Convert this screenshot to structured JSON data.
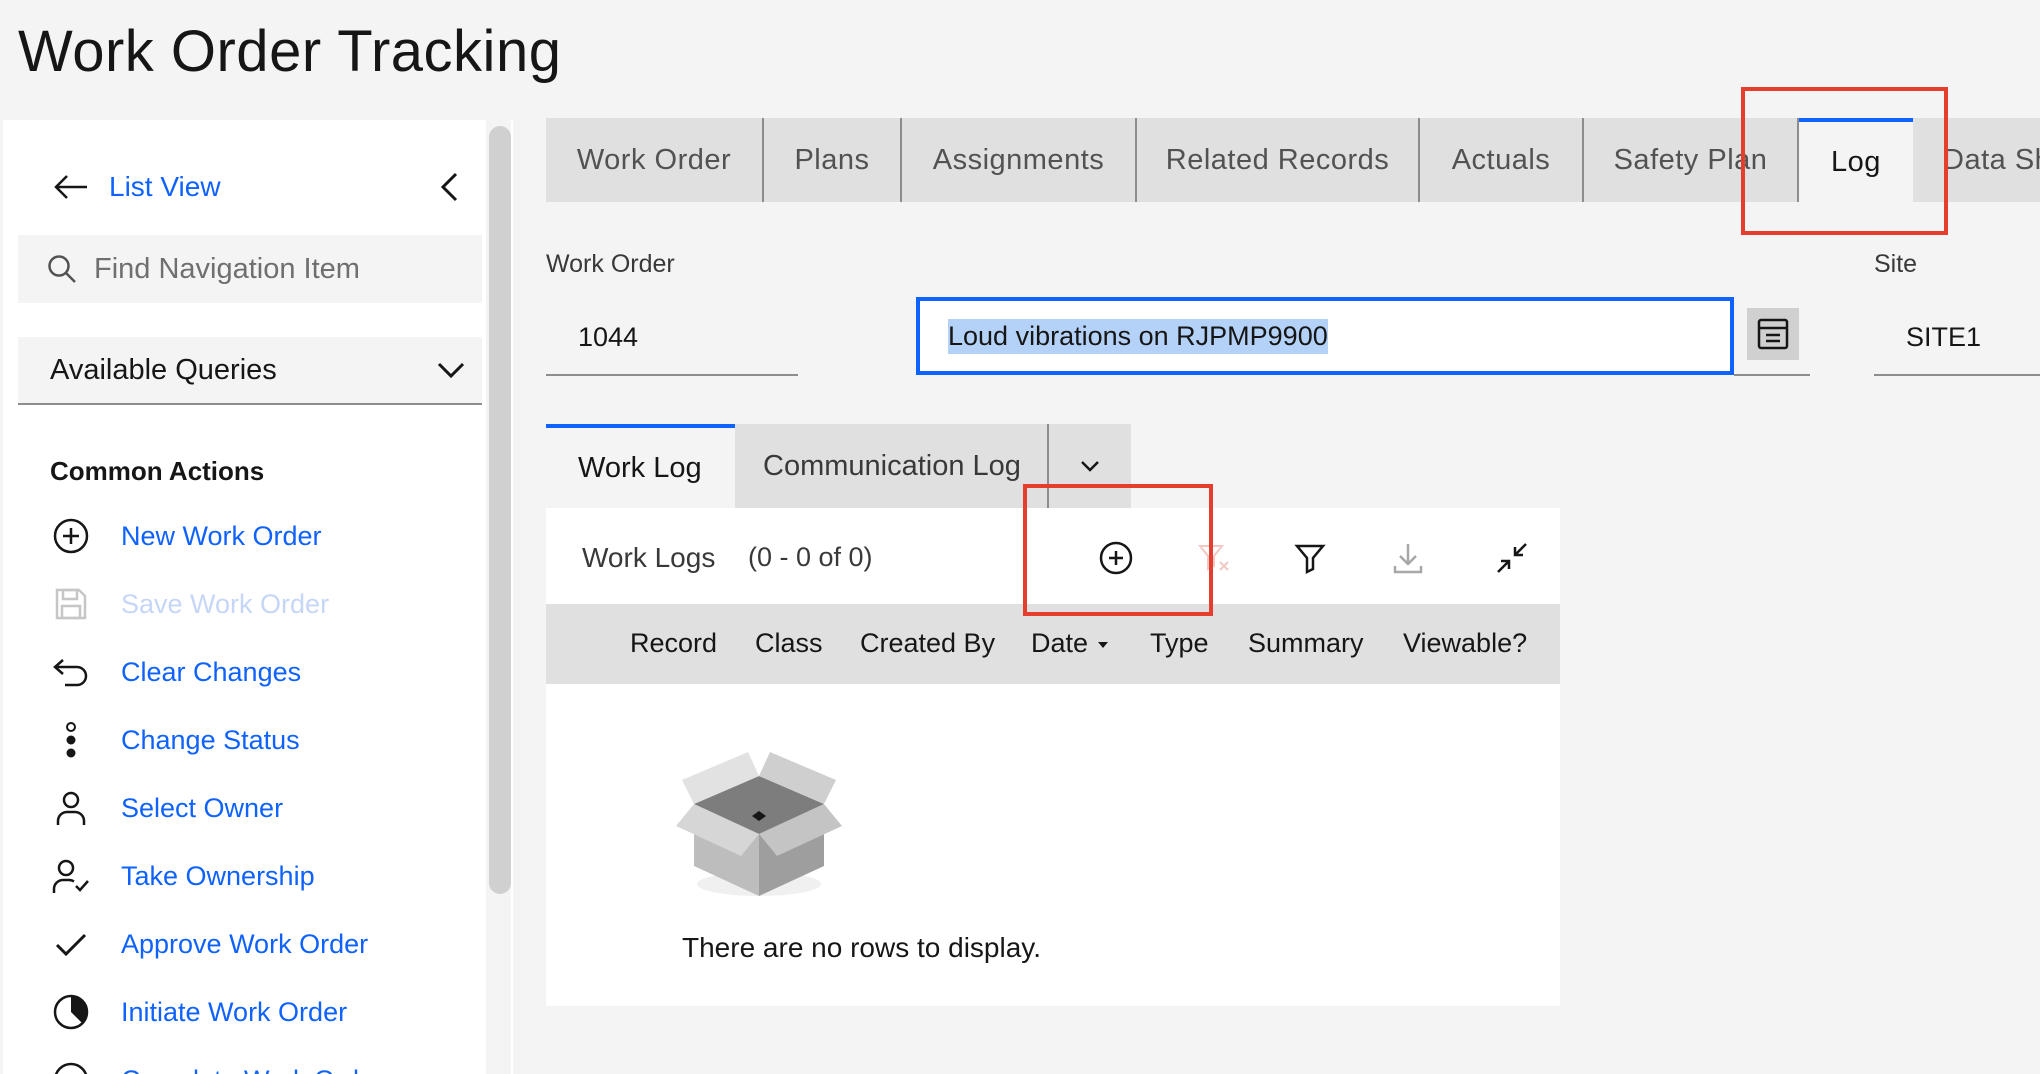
{
  "app": {
    "title": "Work Order Tracking"
  },
  "sidebar": {
    "list_view_label": "List View",
    "search_placeholder": "Find Navigation Item",
    "queries_label": "Available Queries",
    "common_actions_heading": "Common Actions",
    "actions": [
      {
        "label": "New Work Order",
        "icon": "add-circle-icon",
        "enabled": true
      },
      {
        "label": "Save Work Order",
        "icon": "save-icon",
        "enabled": false
      },
      {
        "label": "Clear Changes",
        "icon": "undo-icon",
        "enabled": true
      },
      {
        "label": "Change Status",
        "icon": "status-icon",
        "enabled": true
      },
      {
        "label": "Select Owner",
        "icon": "user-icon",
        "enabled": true
      },
      {
        "label": "Take Ownership",
        "icon": "user-check-icon",
        "enabled": true
      },
      {
        "label": "Approve Work Order",
        "icon": "checkmark-icon",
        "enabled": true
      },
      {
        "label": "Initiate Work Order",
        "icon": "progress-icon",
        "enabled": true
      },
      {
        "label": "Complete Work Order",
        "icon": "circle-icon",
        "enabled": true
      }
    ]
  },
  "tabs": [
    {
      "label": "Work Order",
      "active": false
    },
    {
      "label": "Plans",
      "active": false
    },
    {
      "label": "Assignments",
      "active": false
    },
    {
      "label": "Related Records",
      "active": false
    },
    {
      "label": "Actuals",
      "active": false
    },
    {
      "label": "Safety Plan",
      "active": false
    },
    {
      "label": "Log",
      "active": true
    },
    {
      "label": "Data Sh",
      "active": false
    }
  ],
  "work_order": {
    "label": "Work Order",
    "number": "1044",
    "description": "Loud vibrations on RJPMP9900",
    "site_label": "Site",
    "site_value": "SITE1"
  },
  "subtabs": {
    "work_log": "Work Log",
    "communication_log": "Communication Log"
  },
  "work_logs": {
    "title": "Work Logs",
    "count": "(0 - 0 of 0)",
    "columns": [
      "Record",
      "Class",
      "Created By",
      "Date",
      "Type",
      "Summary",
      "Viewable?"
    ],
    "empty_message": "There are no rows to display."
  },
  "colors": {
    "accent": "#0f62fe",
    "highlight": "#e53e2e"
  }
}
